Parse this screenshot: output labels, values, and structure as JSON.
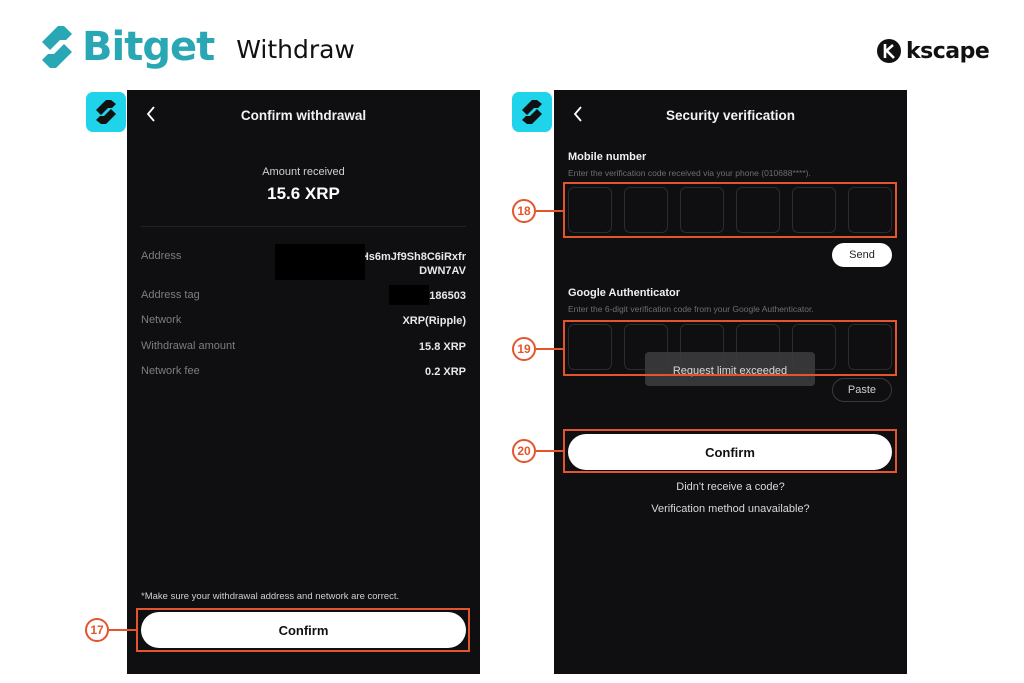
{
  "header": {
    "brand_name": "Bitget",
    "page_title": "Withdraw",
    "partner_name": "kscape",
    "brand_color": "#2aa7b5",
    "accent_color": "#1fd4ea",
    "highlight_color": "#e2552d"
  },
  "left_screen": {
    "nav_title": "Confirm withdrawal",
    "amount_label": "Amount received",
    "amount_value": "15.6 XRP",
    "details": [
      {
        "label": "Address",
        "value_line1": "r04         lHs6mJf9Sh8C6iRxfr",
        "value_line2": "DWN7AV"
      },
      {
        "label": "Address tag",
        "value_line1": "4    186503"
      },
      {
        "label": "Network",
        "value_line1": "XRP(Ripple)"
      },
      {
        "label": "Withdrawal amount",
        "value_line1": "15.8 XRP"
      },
      {
        "label": "Network fee",
        "value_line1": "0.2 XRP"
      }
    ],
    "notice": "*Make sure your withdrawal address and network are correct.",
    "confirm_label": "Confirm",
    "step_number": "17"
  },
  "right_screen": {
    "nav_title": "Security verification",
    "mobile": {
      "title": "Mobile number",
      "hint": "Enter the verification code received via your phone (010688****).",
      "send_label": "Send",
      "step_number": "18",
      "digits": [
        "",
        "",
        "",
        "",
        "",
        ""
      ]
    },
    "google": {
      "title": "Google Authenticator",
      "hint": "Enter the 6-digit verification code from your Google Authenticator.",
      "paste_label": "Paste",
      "step_number": "19",
      "digits": [
        "",
        "",
        "",
        "",
        "",
        ""
      ]
    },
    "toast": "Request limit exceeded",
    "confirm_label": "Confirm",
    "step_number": "20",
    "link_no_code": "Didn't receive a code?",
    "link_unavailable": "Verification method unavailable?"
  }
}
